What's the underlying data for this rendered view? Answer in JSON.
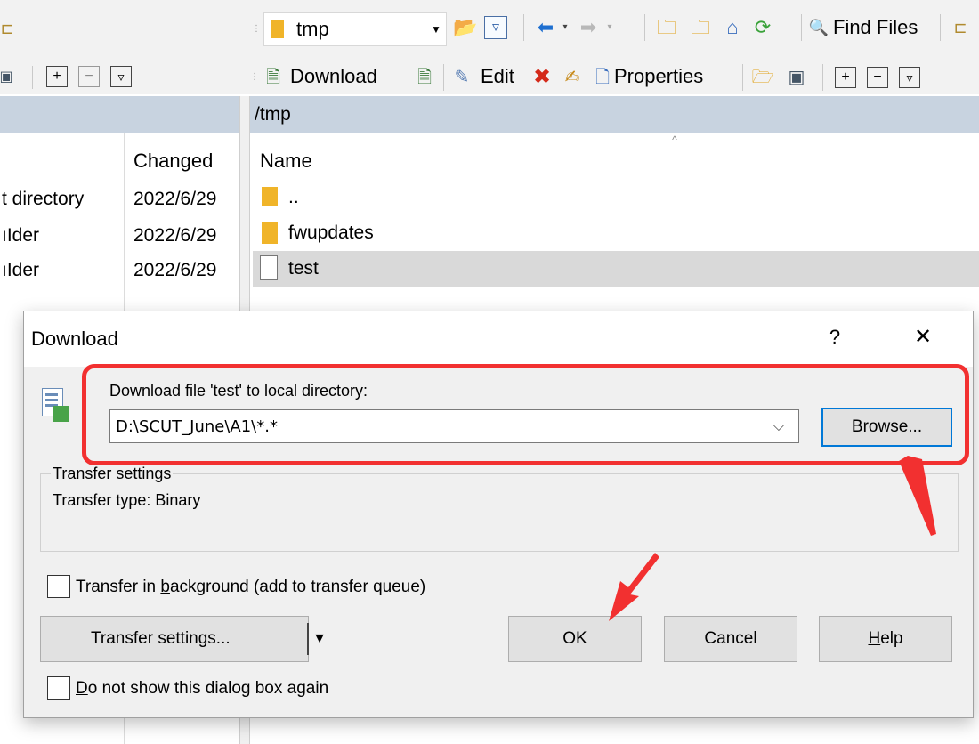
{
  "toolbar": {
    "path_combo": "tmp",
    "find_files_label": "Find Files",
    "download_label": "Download",
    "edit_label": "Edit",
    "properties_label": "Properties"
  },
  "left_pane": {
    "changed_header": "Changed",
    "rows": [
      {
        "name": "t directory",
        "changed": "2022/6/29"
      },
      {
        "name": "ıIder",
        "changed": "2022/6/29"
      },
      {
        "name": "ıIder",
        "changed": "2022/6/29"
      }
    ]
  },
  "right_pane": {
    "path": "/tmp",
    "name_header": "Name",
    "rows": [
      {
        "name": "..",
        "icon": "parent-dir-icon"
      },
      {
        "name": "fwupdates",
        "icon": "folder-icon"
      },
      {
        "name": "test",
        "icon": "file-icon",
        "selected": true
      }
    ]
  },
  "dialog": {
    "title": "Download",
    "help_glyph": "?",
    "close_glyph": "✕",
    "prompt": "Download file 'test' to local directory:",
    "target_path": "D:\\SCUT_June\\A1\\*.*",
    "browse_pre": "Br",
    "browse_u": "o",
    "browse_post": "wse...",
    "group_title": "Transfer settings",
    "transfer_type": "Transfer type: Binary",
    "bg_pre": "Transfer in ",
    "bg_u": "b",
    "bg_post": "ackground (add to transfer queue)",
    "transfer_settings_label": "Transfer settings...",
    "ok_label": "OK",
    "cancel_label": "Cancel",
    "help_u": "H",
    "help_post": "elp",
    "dont_show_u": "D",
    "dont_show_post": "o not show this dialog box again"
  },
  "colors": {
    "annotation": "#f23030",
    "path_bar": "#c8d3e0",
    "selected_row": "#d9d9d9",
    "focus": "#0078d7"
  }
}
